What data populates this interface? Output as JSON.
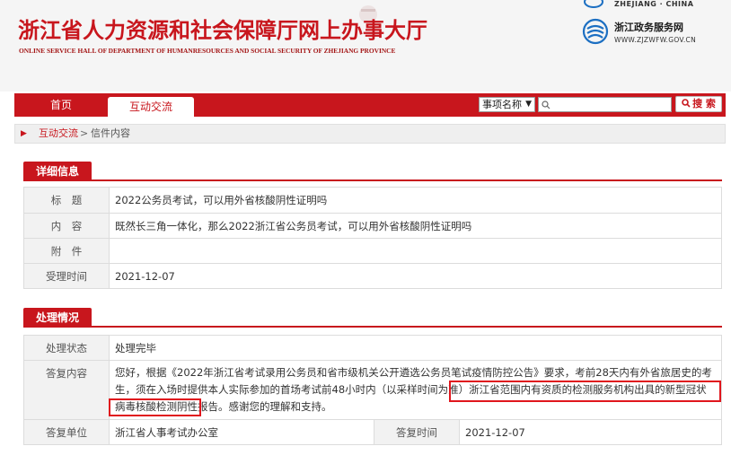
{
  "header": {
    "title": "浙江省人力资源和社会保障厅网上办事大厅",
    "subtitle": "ONLINE SERVICE HALL OF DEPARTMENT OF HUMANRESOURCES AND SOCIAL SECURITY OF ZHEJIANG PROVINCE",
    "top_right_text": "ZHEJIANG · CHINA",
    "portal_name": "浙江政务服务网",
    "portal_url": "WWW.ZJZWFW.GOV.CN"
  },
  "nav": {
    "items": [
      {
        "label": "首页"
      },
      {
        "label": "互动交流"
      }
    ],
    "search": {
      "select_value": "事项名称",
      "input_value": "",
      "button_label": "搜 索"
    }
  },
  "breadcrumb": {
    "link": "互动交流",
    "separator": ">",
    "current": "信件内容"
  },
  "detail": {
    "heading": "详细信息",
    "rows": [
      {
        "label": "标　题",
        "value": "2022公务员考试，可以用外省核酸阴性证明吗"
      },
      {
        "label": "内　容",
        "value": "既然长三角一体化，那么2022浙江省公务员考试，可以用外省核酸阴性证明吗"
      },
      {
        "label": "附　件",
        "value": ""
      },
      {
        "label": "受理时间",
        "value": "2021-12-07"
      }
    ]
  },
  "handling": {
    "heading": "处理情况",
    "status_label": "处理状态",
    "status_value": "处理完毕",
    "reply_label": "答复内容",
    "reply_part1": "您好，根据《2022年浙江省考试录用公务员和省市级机关公开遴选公务员笔试疫情防控公告》要求，考前28天内有外省旅居史的考生，须在入场时提供本人实际参加的首场考试前48小时内（以采样时间为准）",
    "reply_highlight": "浙江省范围内有资质的检测服务机构出具的新型冠状病毒核酸检测阴性报告。",
    "reply_part2": "感谢您的理解和支持。",
    "unit_label": "答复单位",
    "unit_value": "浙江省人事考试办公室",
    "reply_time_label": "答复时间",
    "reply_time_value": "2021-12-07"
  },
  "colors": {
    "brand_red": "#c8161d",
    "highlight_red": "#e0161d"
  }
}
